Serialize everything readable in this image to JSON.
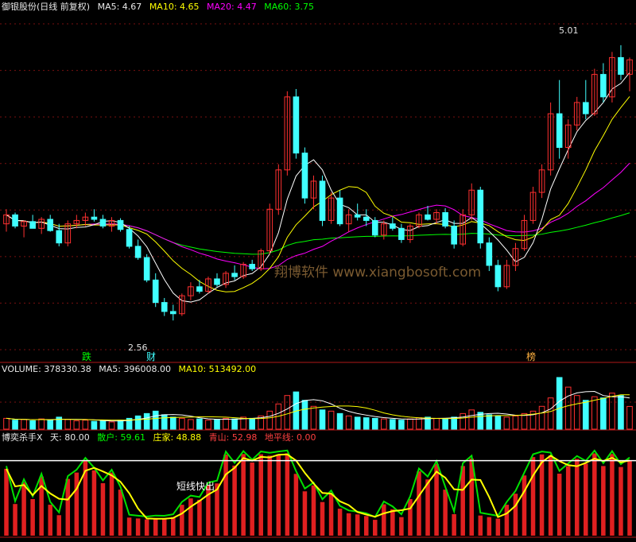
{
  "main_header": {
    "title": "御银股份(日线 前复权)",
    "ma5": "MA5: 4.67",
    "ma10": "MA10: 4.65",
    "ma20": "MA20: 4.47",
    "ma60": "MA60: 3.75"
  },
  "volume_header": {
    "volume": "VOLUME: 378330.38",
    "ma5": "MA5: 396008.00",
    "ma10": "MA10: 513492.00"
  },
  "indicator_header": {
    "name": "博奕杀手X",
    "tian": "天: 80.00",
    "sanhu": "散户: 59.61",
    "zhuangjia": "庄家: 48.88",
    "qingshan": "青山: 52.98",
    "dipingxian": "地平线: 0.00"
  },
  "watermark": "翔博软件 www.xiangbosoft.com",
  "annotations": {
    "high_label": "5.01",
    "low_label": "2.56",
    "tag_die": "跌",
    "tag_cai": "财",
    "tag_bang": "榜",
    "indicator_note": "短线快出"
  },
  "chart_data": {
    "type": "candlestick",
    "price_ylim": [
      2.3,
      5.2
    ],
    "colors": {
      "up": "#ff3030",
      "down": "#40ffff",
      "ma5": "#ffffff",
      "ma10": "#ffff00",
      "ma20": "#ff00ff",
      "ma60": "#00ff00"
    },
    "candles_ohlc": [
      [
        3.42,
        3.55,
        3.35,
        3.5
      ],
      [
        3.5,
        3.52,
        3.38,
        3.4
      ],
      [
        3.4,
        3.45,
        3.3,
        3.44
      ],
      [
        3.44,
        3.5,
        3.38,
        3.38
      ],
      [
        3.38,
        3.48,
        3.33,
        3.46
      ],
      [
        3.46,
        3.5,
        3.35,
        3.36
      ],
      [
        3.36,
        3.42,
        3.22,
        3.25
      ],
      [
        3.25,
        3.45,
        3.22,
        3.42
      ],
      [
        3.42,
        3.5,
        3.38,
        3.45
      ],
      [
        3.45,
        3.52,
        3.4,
        3.48
      ],
      [
        3.48,
        3.55,
        3.44,
        3.46
      ],
      [
        3.46,
        3.5,
        3.38,
        3.4
      ],
      [
        3.4,
        3.48,
        3.35,
        3.45
      ],
      [
        3.45,
        3.47,
        3.35,
        3.37
      ],
      [
        3.37,
        3.4,
        3.2,
        3.22
      ],
      [
        3.22,
        3.28,
        3.1,
        3.12
      ],
      [
        3.12,
        3.15,
        2.9,
        2.92
      ],
      [
        2.92,
        2.98,
        2.68,
        2.72
      ],
      [
        2.72,
        2.76,
        2.6,
        2.64
      ],
      [
        2.64,
        2.7,
        2.56,
        2.62
      ],
      [
        2.62,
        2.8,
        2.6,
        2.78
      ],
      [
        2.78,
        2.9,
        2.74,
        2.86
      ],
      [
        2.86,
        2.92,
        2.8,
        2.82
      ],
      [
        2.82,
        2.95,
        2.8,
        2.93
      ],
      [
        2.93,
        2.98,
        2.86,
        2.88
      ],
      [
        2.88,
        3.0,
        2.85,
        2.98
      ],
      [
        2.98,
        3.05,
        2.92,
        2.95
      ],
      [
        2.95,
        3.08,
        2.93,
        3.06
      ],
      [
        3.06,
        3.1,
        3.0,
        3.02
      ],
      [
        3.02,
        3.2,
        3.0,
        3.18
      ],
      [
        3.18,
        3.6,
        3.15,
        3.55
      ],
      [
        3.55,
        3.95,
        3.5,
        3.9
      ],
      [
        3.9,
        4.6,
        3.85,
        4.55
      ],
      [
        4.55,
        4.62,
        4.0,
        4.05
      ],
      [
        4.05,
        4.1,
        3.6,
        3.65
      ],
      [
        3.65,
        3.85,
        3.55,
        3.8
      ],
      [
        3.8,
        3.85,
        3.4,
        3.45
      ],
      [
        3.45,
        3.7,
        3.42,
        3.65
      ],
      [
        3.65,
        3.72,
        3.4,
        3.42
      ],
      [
        3.42,
        3.55,
        3.35,
        3.5
      ],
      [
        3.5,
        3.6,
        3.45,
        3.48
      ],
      [
        3.48,
        3.55,
        3.4,
        3.45
      ],
      [
        3.45,
        3.48,
        3.3,
        3.32
      ],
      [
        3.32,
        3.45,
        3.28,
        3.42
      ],
      [
        3.42,
        3.48,
        3.36,
        3.38
      ],
      [
        3.38,
        3.42,
        3.25,
        3.28
      ],
      [
        3.28,
        3.42,
        3.25,
        3.4
      ],
      [
        3.4,
        3.52,
        3.38,
        3.5
      ],
      [
        3.5,
        3.58,
        3.45,
        3.46
      ],
      [
        3.46,
        3.55,
        3.42,
        3.52
      ],
      [
        3.52,
        3.56,
        3.38,
        3.4
      ],
      [
        3.4,
        3.45,
        3.2,
        3.24
      ],
      [
        3.24,
        3.55,
        3.22,
        3.5
      ],
      [
        3.5,
        3.78,
        3.45,
        3.72
      ],
      [
        3.72,
        3.75,
        3.2,
        3.25
      ],
      [
        3.25,
        3.3,
        3.0,
        3.05
      ],
      [
        3.05,
        3.1,
        2.82,
        2.86
      ],
      [
        2.86,
        3.1,
        2.84,
        3.05
      ],
      [
        3.05,
        3.25,
        3.0,
        3.2
      ],
      [
        3.2,
        3.5,
        3.18,
        3.45
      ],
      [
        3.45,
        3.75,
        3.42,
        3.7
      ],
      [
        3.7,
        3.95,
        3.65,
        3.9
      ],
      [
        3.9,
        4.5,
        3.85,
        4.4
      ],
      [
        4.4,
        4.7,
        4.0,
        4.1
      ],
      [
        4.1,
        4.35,
        4.0,
        4.3
      ],
      [
        4.3,
        4.55,
        4.25,
        4.5
      ],
      [
        4.5,
        4.7,
        4.35,
        4.4
      ],
      [
        4.4,
        4.8,
        4.38,
        4.75
      ],
      [
        4.75,
        4.85,
        4.5,
        4.55
      ],
      [
        4.55,
        4.95,
        4.5,
        4.9
      ],
      [
        4.9,
        5.01,
        4.7,
        4.75
      ],
      [
        4.75,
        4.9,
        4.6,
        4.88
      ]
    ],
    "volume_ylim": [
      0,
      900000
    ],
    "volume": [
      180000,
      150000,
      160000,
      140000,
      170000,
      150000,
      200000,
      160000,
      140000,
      150000,
      130000,
      140000,
      120000,
      150000,
      180000,
      220000,
      260000,
      300000,
      240000,
      200000,
      180000,
      160000,
      170000,
      150000,
      160000,
      180000,
      170000,
      200000,
      180000,
      220000,
      300000,
      420000,
      560000,
      620000,
      480000,
      380000,
      320000,
      300000,
      260000,
      220000,
      200000,
      190000,
      180000,
      170000,
      160000,
      150000,
      170000,
      190000,
      200000,
      180000,
      170000,
      200000,
      260000,
      320000,
      280000,
      240000,
      220000,
      200000,
      220000,
      260000,
      300000,
      380000,
      520000,
      860000,
      700000,
      560000,
      480000,
      540000,
      520000,
      600000,
      560000,
      378330
    ],
    "indicator_ylim": [
      0,
      100
    ],
    "indicator_tian": 80
  }
}
